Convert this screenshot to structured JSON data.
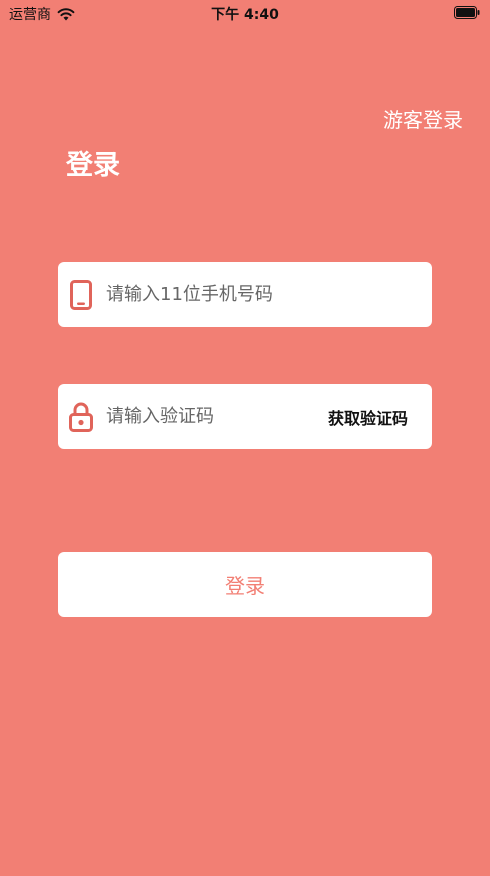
{
  "status_bar": {
    "carrier": "运营商",
    "time": "下午 4:40"
  },
  "header": {
    "guest_login": "游客登录",
    "title": "登录"
  },
  "form": {
    "phone_placeholder": "请输入11位手机号码",
    "code_placeholder": "请输入验证码",
    "get_code_label": "获取验证码",
    "submit_label": "登录"
  },
  "icons": {
    "phone": "phone-icon",
    "lock": "lock-icon"
  },
  "colors": {
    "background": "#f27f74",
    "card": "#ffffff",
    "accent": "#f27f74",
    "icon": "#e0645a"
  }
}
